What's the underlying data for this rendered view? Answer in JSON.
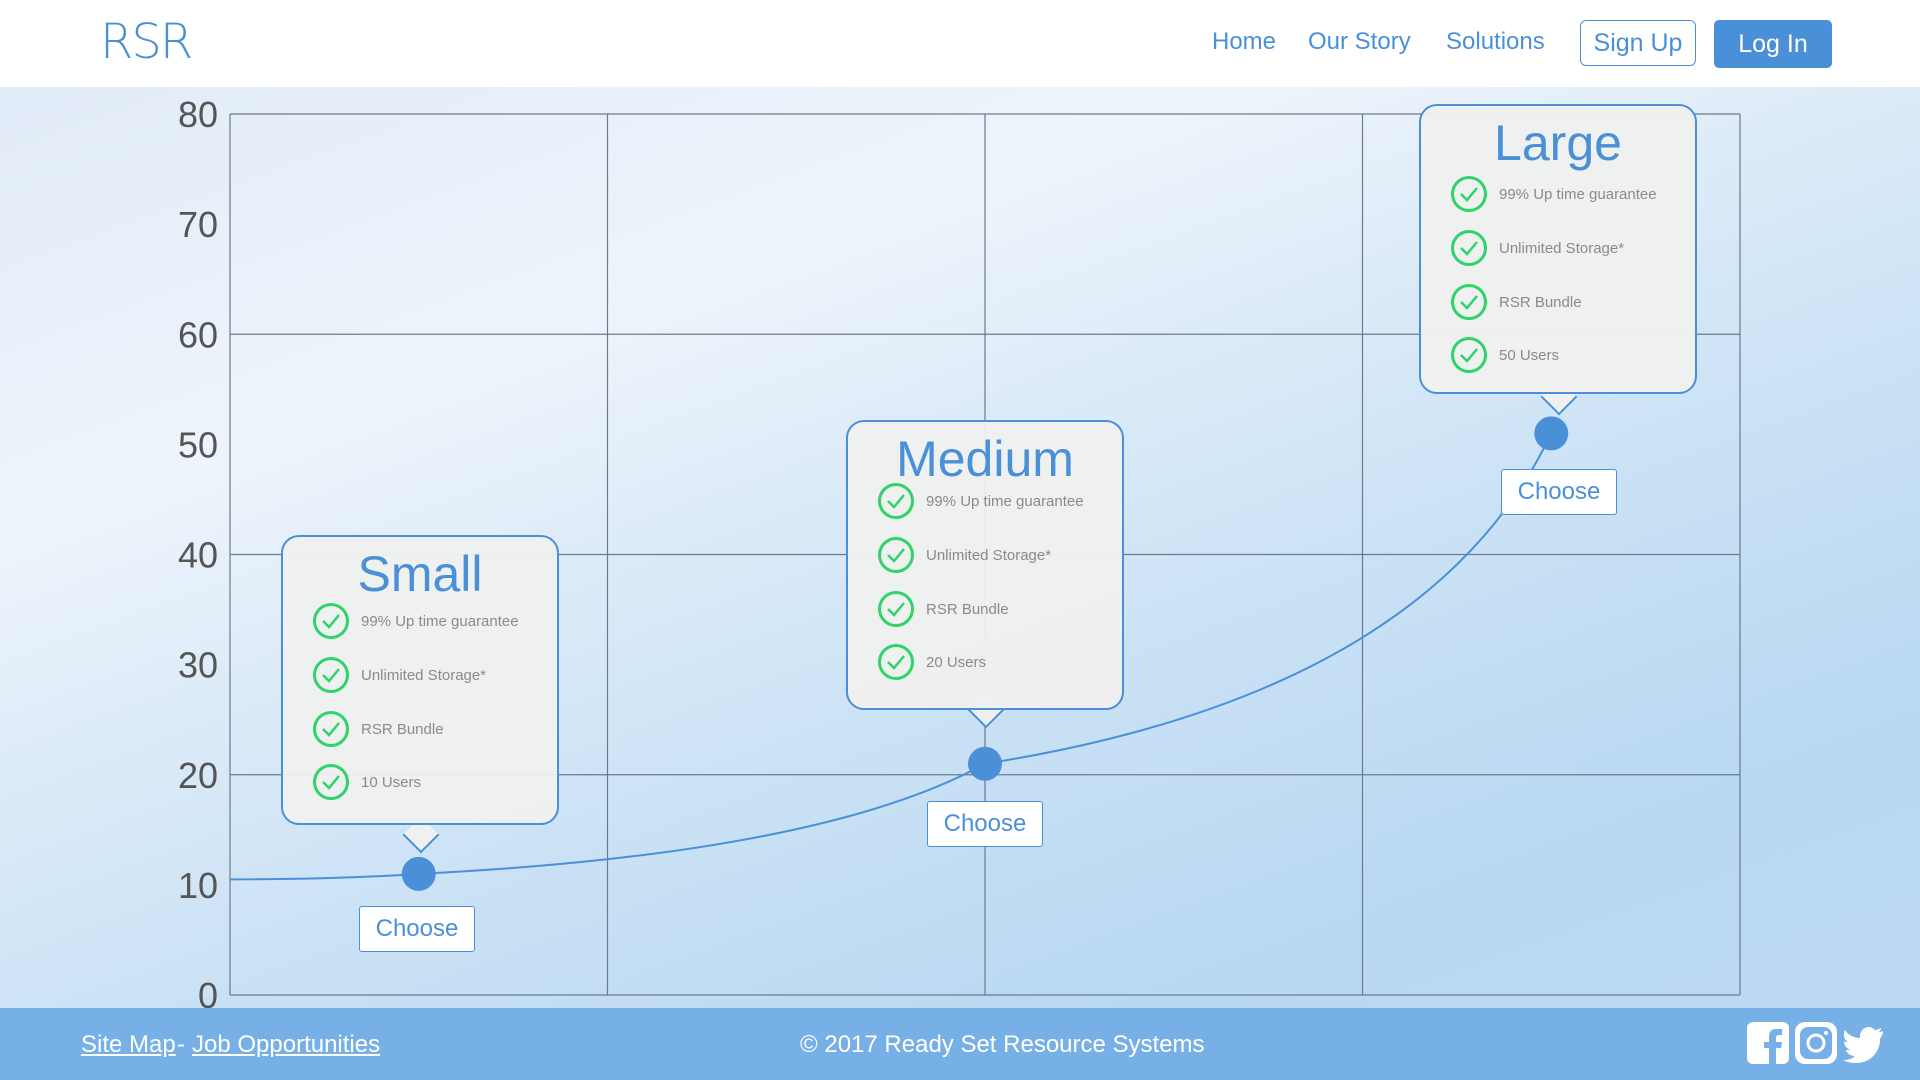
{
  "header": {
    "logo": "RSR",
    "nav": [
      "Home",
      "Our Story",
      "Solutions"
    ],
    "signup_label": "Sign Up",
    "login_label": "Log In"
  },
  "colors": {
    "accent": "#4a90d9",
    "check": "#2ed36a",
    "footer": "#76b0e6"
  },
  "chart_data": {
    "type": "line",
    "y_ticks": [
      "80",
      "70",
      "60",
      "50",
      "40",
      "30",
      "20",
      "10",
      "0"
    ],
    "ylim": [
      0,
      80
    ],
    "grid": true,
    "points": [
      {
        "name": "Small",
        "x": 0.5,
        "y": 11
      },
      {
        "name": "Medium",
        "x": 2.0,
        "y": 21
      },
      {
        "name": "Large",
        "x": 3.5,
        "y": 51
      }
    ]
  },
  "plans": [
    {
      "name": "Small",
      "features": [
        "99% Up time guarantee",
        "Unlimited Storage*",
        "RSR Bundle",
        "10 Users"
      ],
      "choose_label": "Choose"
    },
    {
      "name": "Medium",
      "features": [
        "99% Up time guarantee",
        "Unlimited Storage*",
        "RSR Bundle",
        "20 Users"
      ],
      "choose_label": "Choose"
    },
    {
      "name": "Large",
      "features": [
        "99% Up time guarantee",
        "Unlimited Storage*",
        "RSR Bundle",
        "50 Users"
      ],
      "choose_label": "Choose"
    }
  ],
  "footer": {
    "site_map": "Site Map",
    "separator": "-",
    "jobs": "Job Opportunities",
    "copyright": "© 2017 Ready Set Resource Systems",
    "social": [
      "facebook-icon",
      "instagram-icon",
      "twitter-icon"
    ]
  }
}
